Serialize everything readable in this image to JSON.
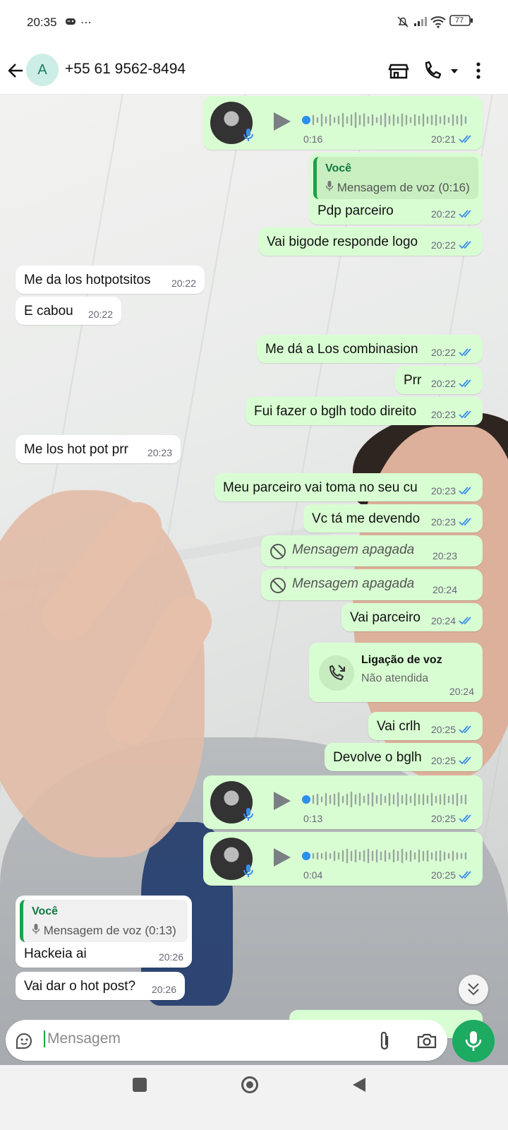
{
  "status_bar": {
    "time": "20:35",
    "extras": "⋯",
    "battery": "77"
  },
  "header": {
    "avatar_letter": "A",
    "title": "+55 61 9562-8494"
  },
  "messages": [
    {
      "type": "voice",
      "dir": "out",
      "duration": "0:16",
      "time": "20:21"
    },
    {
      "type": "quote",
      "dir": "out",
      "quote_name": "Você",
      "quote_body": "Mensagem de voz (0:16)",
      "text": "Pdp parceiro",
      "time": "20:22"
    },
    {
      "type": "text",
      "dir": "out",
      "text": "Vai bigode responde logo",
      "time": "20:22"
    },
    {
      "type": "text",
      "dir": "in",
      "text": "Me da los hotpotsitos",
      "time": "20:22"
    },
    {
      "type": "text",
      "dir": "in",
      "text": "E cabou",
      "time": "20:22"
    },
    {
      "type": "text",
      "dir": "out",
      "text": "Me dá a Los combinasion",
      "time": "20:22"
    },
    {
      "type": "text",
      "dir": "out",
      "text": "Prr",
      "time": "20:22"
    },
    {
      "type": "text",
      "dir": "out",
      "text": "Fui fazer o bglh todo direito",
      "time": "20:23"
    },
    {
      "type": "text",
      "dir": "in",
      "text": "Me los hot pot prr",
      "time": "20:23"
    },
    {
      "type": "text",
      "dir": "out",
      "text": "Meu parceiro vai toma no seu cu",
      "time": "20:23"
    },
    {
      "type": "text",
      "dir": "out",
      "text": "Vc tá me devendo",
      "time": "20:23"
    },
    {
      "type": "deleted",
      "dir": "out",
      "text": "Mensagem apagada",
      "time": "20:23"
    },
    {
      "type": "deleted",
      "dir": "out",
      "text": "Mensagem apagada",
      "time": "20:24"
    },
    {
      "type": "text",
      "dir": "out",
      "text": "Vai parceiro",
      "time": "20:24"
    },
    {
      "type": "call",
      "dir": "out",
      "title": "Ligação de voz",
      "subtitle": "Não atendida",
      "time": "20:24"
    },
    {
      "type": "text",
      "dir": "out",
      "text": "Vai crlh",
      "time": "20:25"
    },
    {
      "type": "text",
      "dir": "out",
      "text": "Devolve o bglh",
      "time": "20:25"
    },
    {
      "type": "voice",
      "dir": "out",
      "duration": "0:13",
      "time": "20:25"
    },
    {
      "type": "voice",
      "dir": "out",
      "duration": "0:04",
      "time": "20:25"
    },
    {
      "type": "quote",
      "dir": "in",
      "quote_name": "Você",
      "quote_body": "Mensagem de voz (0:13)",
      "text": "Hackeia ai",
      "time": "20:26"
    },
    {
      "type": "text",
      "dir": "in",
      "text": "Vai dar o hot post?",
      "time": "20:26"
    }
  ],
  "input": {
    "placeholder": "Mensagem"
  },
  "icons": {
    "back": "arrow-left-icon",
    "store": "storefront-icon",
    "call": "phone-icon",
    "menu": "more-vert-icon",
    "emoji": "sticker-icon",
    "attach": "paperclip-icon",
    "camera": "camera-icon",
    "mic": "microphone-icon"
  },
  "colors": {
    "outgoing": "#d9fdd3",
    "incoming": "#ffffff",
    "accent": "#1daa61",
    "read_tick": "#3b8ee8"
  }
}
